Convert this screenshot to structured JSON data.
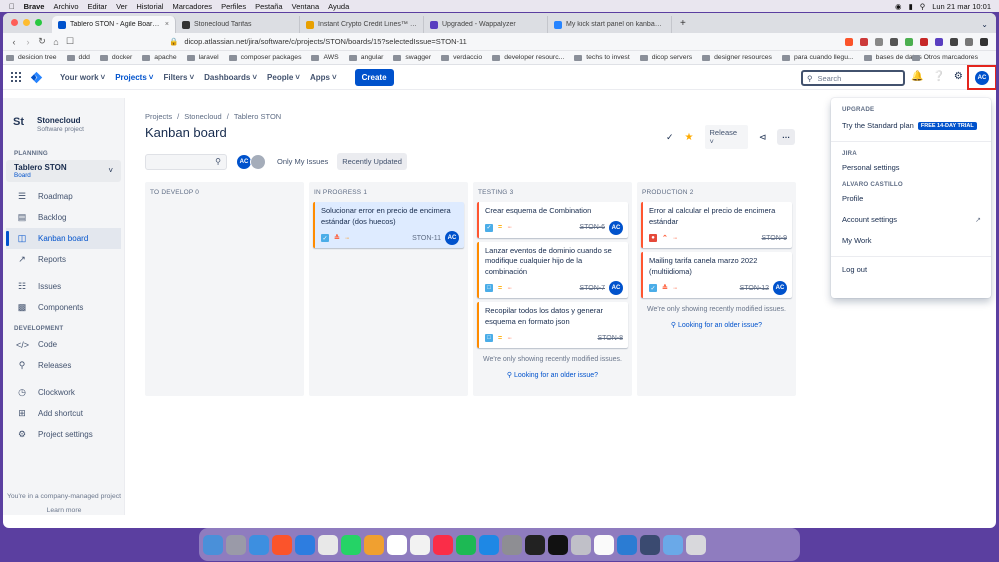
{
  "menubar": {
    "apple": "",
    "app": "Brave",
    "items": [
      "Archivo",
      "Editar",
      "Ver",
      "Historial",
      "Marcadores",
      "Perfiles",
      "Pestaña",
      "Ventana",
      "Ayuda"
    ],
    "clock": "Lun 21 mar  10:01"
  },
  "browser": {
    "tabs": [
      {
        "title": "Tablero STON - Agile Board - Jir",
        "color": "#0052cc"
      },
      {
        "title": "Stonecloud Tarifas",
        "color": "#333"
      },
      {
        "title": "Instant Crypto Credit Lines™ – Borr",
        "color": "#e8a000"
      },
      {
        "title": "Upgraded - Wappalyzer",
        "color": "#5a3fc0"
      },
      {
        "title": "My kick start panel on kanban boar",
        "color": "#2684ff"
      }
    ],
    "new_tab": "+",
    "url": "dicop.atlassian.net/jira/software/c/projects/STON/boards/15?selectedIssue=STON-11",
    "bookmarks": [
      "desicion tree",
      "ddd",
      "docker",
      "apache",
      "laravel",
      "composer packages",
      "AWS",
      "angular",
      "swagger",
      "verdaccio",
      "developer resourc...",
      "techs to invest",
      "dicop servers",
      "designer resources",
      "para cuando llegu...",
      "bases de datos"
    ],
    "other_bookmarks": "Otros marcadores"
  },
  "topnav": {
    "menus": [
      "Your work",
      "Projects",
      "Filters",
      "Dashboards",
      "People",
      "Apps"
    ],
    "create": "Create",
    "search_placeholder": "Search",
    "avatar": "AC"
  },
  "sidebar": {
    "project_name": "Stonecloud",
    "project_type": "Software project",
    "logo_text": "St",
    "planning_label": "PLANNING",
    "board_name": "Tablero STON",
    "board_type": "Board",
    "planning_items": [
      "Roadmap",
      "Backlog",
      "Kanban board",
      "Reports"
    ],
    "other_items": [
      "Issues",
      "Components"
    ],
    "development_label": "DEVELOPMENT",
    "dev_items": [
      "Code",
      "Releases"
    ],
    "extra_items": [
      "Clockwork",
      "Add shortcut",
      "Project settings"
    ],
    "footer_text": "You're in a company-managed project",
    "learn_more": "Learn more"
  },
  "main": {
    "breadcrumbs": [
      "Projects",
      "Stonecloud",
      "Tablero STON"
    ],
    "title": "Kanban board",
    "release": "Release",
    "filters": {
      "avatar": "AC",
      "only_my": "Only My Issues",
      "recent": "Recently Updated"
    },
    "columns": [
      {
        "name": "TO DEVELOP 0",
        "cards": []
      },
      {
        "name": "IN PROGRESS 1",
        "cards": [
          {
            "summary": "Solucionar error en precio de encimera estándar (dos huecos)",
            "key": "STON-11",
            "type": "task",
            "done": false,
            "avatar": "AC"
          }
        ]
      },
      {
        "name": "TESTING 3",
        "cards": [
          {
            "summary": "Crear esquema de Combination",
            "key": "STON-6",
            "type": "task",
            "done": true,
            "avatar": "AC"
          },
          {
            "summary": "Lanzar eventos de dominio cuando se modifique cualquier hijo de la combinación",
            "key": "STON-7",
            "type": "story",
            "done": true,
            "avatar": "AC"
          },
          {
            "summary": "Recopilar todos los datos y generar esquema en formato json",
            "key": "STON-8",
            "type": "task",
            "done": true,
            "avatar": ""
          }
        ],
        "note": "We're only showing recently modified issues.",
        "link": "Looking for an older issue?"
      },
      {
        "name": "PRODUCTION 2",
        "cards": [
          {
            "summary": "Error al calcular el precio de encimera estándar",
            "key": "STON-9",
            "type": "bug",
            "done": true,
            "avatar": ""
          },
          {
            "summary": "Mailing tarifa canela marzo 2022 (multiidioma)",
            "key": "STON-12",
            "type": "task",
            "done": true,
            "avatar": "AC"
          }
        ],
        "note": "We're only showing recently modified issues.",
        "link": "Looking for an older issue?"
      }
    ]
  },
  "dropdown": {
    "upgrade_label": "UPGRADE",
    "try_plan": "Try the Standard plan",
    "trial_badge": "FREE 14-DAY TRIAL",
    "jira_label": "JIRA",
    "personal_settings": "Personal settings",
    "user_label": "ALVARO CASTILLO",
    "profile": "Profile",
    "account_settings": "Account settings",
    "my_work": "My Work",
    "logout": "Log out"
  },
  "colors": {
    "accent": "#0052cc",
    "highlight": "#e3251d",
    "task": "#4bade8",
    "story": "#63ba3c",
    "bug": "#e5493a"
  }
}
